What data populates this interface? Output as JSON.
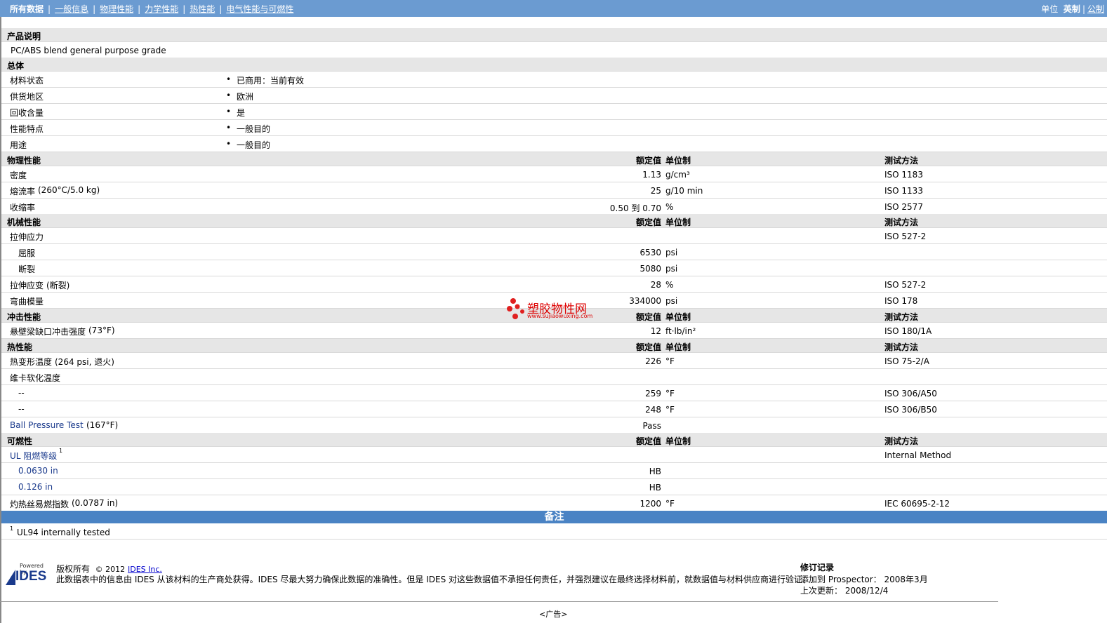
{
  "nav": {
    "items": [
      "所有数据",
      "一般信息",
      "物理性能",
      "力学性能",
      "热性能",
      "电气性能与可燃性"
    ],
    "unit_label": "单位",
    "units": [
      "英制",
      "公制"
    ]
  },
  "desc": {
    "title": "产品说明",
    "text": "PC/ABS blend general purpose grade"
  },
  "general": {
    "title": "总体",
    "rows": [
      {
        "label": "材料状态",
        "value": "已商用：当前有效"
      },
      {
        "label": "供货地区",
        "value": "欧洲"
      },
      {
        "label": "回收含量",
        "value": "是"
      },
      {
        "label": "性能特点",
        "value": "一般目的"
      },
      {
        "label": "用途",
        "value": "一般目的"
      }
    ]
  },
  "headers": {
    "nominal": "额定值",
    "unit": "单位制",
    "method": "测试方法"
  },
  "physical": {
    "title": "物理性能",
    "rows": [
      {
        "label": "密度",
        "value": "1.13",
        "unit": "g/cm³",
        "method": "ISO 1183"
      },
      {
        "label": "熔流率",
        "cond": "(260°C/5.0 kg)",
        "value": "25",
        "unit": "g/10 min",
        "method": "ISO 1133"
      },
      {
        "label": "收缩率",
        "value": "0.50 到 0.70",
        "unit": "%",
        "method": "ISO 2577"
      }
    ]
  },
  "mechanical": {
    "title": "机械性能",
    "rows": [
      {
        "label": "拉伸应力",
        "value": "",
        "unit": "",
        "method": "ISO 527-2"
      },
      {
        "label": "屈服",
        "sub": true,
        "value": "6530",
        "unit": "psi",
        "method": ""
      },
      {
        "label": "断裂",
        "sub": true,
        "value": "5080",
        "unit": "psi",
        "method": ""
      },
      {
        "label": "拉伸应变",
        "cond": "(断裂)",
        "value": "28",
        "unit": "%",
        "method": "ISO 527-2"
      },
      {
        "label": "弯曲模量",
        "value": "334000",
        "unit": "psi",
        "method": "ISO 178"
      }
    ]
  },
  "impact": {
    "title": "冲击性能",
    "rows": [
      {
        "label": "悬壁梁缺口冲击强度",
        "cond": "(73°F)",
        "value": "12",
        "unit": "ft·lb/in²",
        "method": "ISO 180/1A"
      }
    ]
  },
  "thermal": {
    "title": "热性能",
    "rows": [
      {
        "label": "热变形温度",
        "cond": "(264 psi, 退火)",
        "value": "226",
        "unit": "°F",
        "method": "ISO 75-2/A"
      },
      {
        "label": "维卡软化温度",
        "value": "",
        "unit": "",
        "method": ""
      },
      {
        "label": "--",
        "sub": true,
        "value": "259",
        "unit": "°F",
        "method": "ISO 306/A50"
      },
      {
        "label": "--",
        "sub": true,
        "value": "248",
        "unit": "°F",
        "method": "ISO 306/B50"
      },
      {
        "label": "Ball Pressure Test",
        "cond": "(167°F)",
        "value": "Pass",
        "unit": "",
        "method": ""
      }
    ]
  },
  "flame": {
    "title": "可燃性",
    "rows": [
      {
        "label": "UL 阻燃等级",
        "sup": "1",
        "value": "",
        "unit": "",
        "method": "Internal Method"
      },
      {
        "label": "0.0630 in",
        "sub": true,
        "value": "HB",
        "unit": "",
        "method": ""
      },
      {
        "label": "0.126 in",
        "sub": true,
        "value": "HB",
        "unit": "",
        "method": ""
      },
      {
        "label": "灼热丝易燃指数",
        "cond": "(0.0787 in)",
        "value": "1200",
        "unit": "°F",
        "method": "IEC 60695-2-12"
      }
    ]
  },
  "notes": {
    "title": "备注",
    "sup": "1",
    "text": "UL94 internally tested"
  },
  "watermark": {
    "text": "塑胶物性网",
    "url": "www.sujiaowuxing.com"
  },
  "footer": {
    "logo_top": "Powered by",
    "logo": "IDES",
    "copyright_label": "版权所有",
    "copyright_year": "© 2012",
    "company": "IDES Inc.",
    "disclaimer": "此数据表中的信息由 IDES 从该材料的生产商处获得。IDES 尽最大努力确保此数据的准确性。但是 IDES 对这些数据值不承担任何责任，并强烈建议在最终选择材料前，就数据值与材料供应商进行验证。",
    "rev_title": "修订记录",
    "added_label": "添加到 Prospector：",
    "added_value": "2008年3月",
    "updated_label": "上次更新：",
    "updated_value": "2008/12/4",
    "ad": "<广告>"
  }
}
